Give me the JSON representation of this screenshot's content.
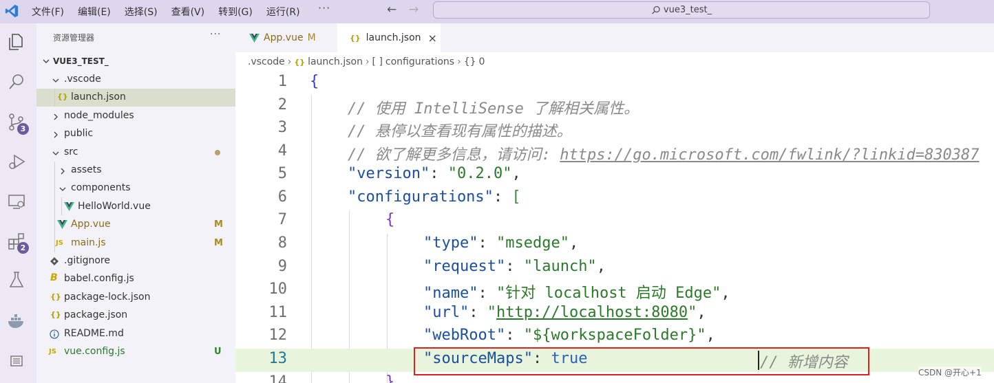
{
  "titlebar": {
    "menu": [
      "文件(F)",
      "编辑(E)",
      "选择(S)",
      "查看(V)",
      "转到(G)",
      "运行(R)"
    ],
    "more": "···",
    "search_text": "vue3_test_"
  },
  "activity_badges": {
    "source_control": "3",
    "extensions": "2"
  },
  "sidebar": {
    "title": "资源管理器",
    "more": "···",
    "project": "VUE3_TEST_",
    "items": [
      {
        "label": ".vscode"
      },
      {
        "label": "launch.json"
      },
      {
        "label": "node_modules"
      },
      {
        "label": "public"
      },
      {
        "label": "src"
      },
      {
        "label": "assets"
      },
      {
        "label": "components"
      },
      {
        "label": "HelloWorld.vue"
      },
      {
        "label": "App.vue",
        "status": "M"
      },
      {
        "label": "main.js",
        "status": "M"
      },
      {
        "label": ".gitignore"
      },
      {
        "label": "babel.config.js"
      },
      {
        "label": "package-lock.json"
      },
      {
        "label": "package.json"
      },
      {
        "label": "README.md"
      },
      {
        "label": "vue.config.js",
        "status": "U"
      }
    ],
    "icons": {
      "json": "{}",
      "js": "JS",
      "vue_color": "#41b883",
      "js_color": "#c9a900",
      "json_color": "#b8a000"
    }
  },
  "tabs": [
    {
      "label": "App.vue",
      "status": "M"
    },
    {
      "label": "launch.json"
    }
  ],
  "breadcrumb": {
    "folder": ".vscode",
    "file": "launch.json",
    "file_icon": "{}",
    "array_icon": "[ ]",
    "array": "configurations",
    "object_icon": "{}",
    "object": "0"
  },
  "code": {
    "line_numbers": [
      "1",
      "2",
      "3",
      "4",
      "5",
      "6",
      "7",
      "8",
      "9",
      "10",
      "11",
      "12",
      "13",
      "14"
    ],
    "comment1": "// 使用 IntelliSense 了解相关属性。",
    "comment2": "// 悬停以查看现有属性的描述。",
    "comment3_prefix": "// 欲了解更多信息，请访问: ",
    "comment3_link": "https://go.microsoft.com/fwlink/?linkid=830387",
    "version_key": "\"version\"",
    "version_val": "\"0.2.0\"",
    "configurations_key": "\"configurations\"",
    "type_key": "\"type\"",
    "type_val": "\"msedge\"",
    "request_key": "\"request\"",
    "request_val": "\"launch\"",
    "name_key": "\"name\"",
    "name_val": "\"针对 localhost 启动 Edge\"",
    "url_key": "\"url\"",
    "url_open": "\"",
    "url_val": "http://localhost:8080",
    "url_close": "\"",
    "webroot_key": "\"webRoot\"",
    "webroot_val": "\"${workspaceFolder}\"",
    "sourcemaps_key": "\"sourceMaps\"",
    "sourcemaps_val": "true",
    "new_comment": "// 新增内容"
  },
  "watermark": "CSDN @开心+1"
}
